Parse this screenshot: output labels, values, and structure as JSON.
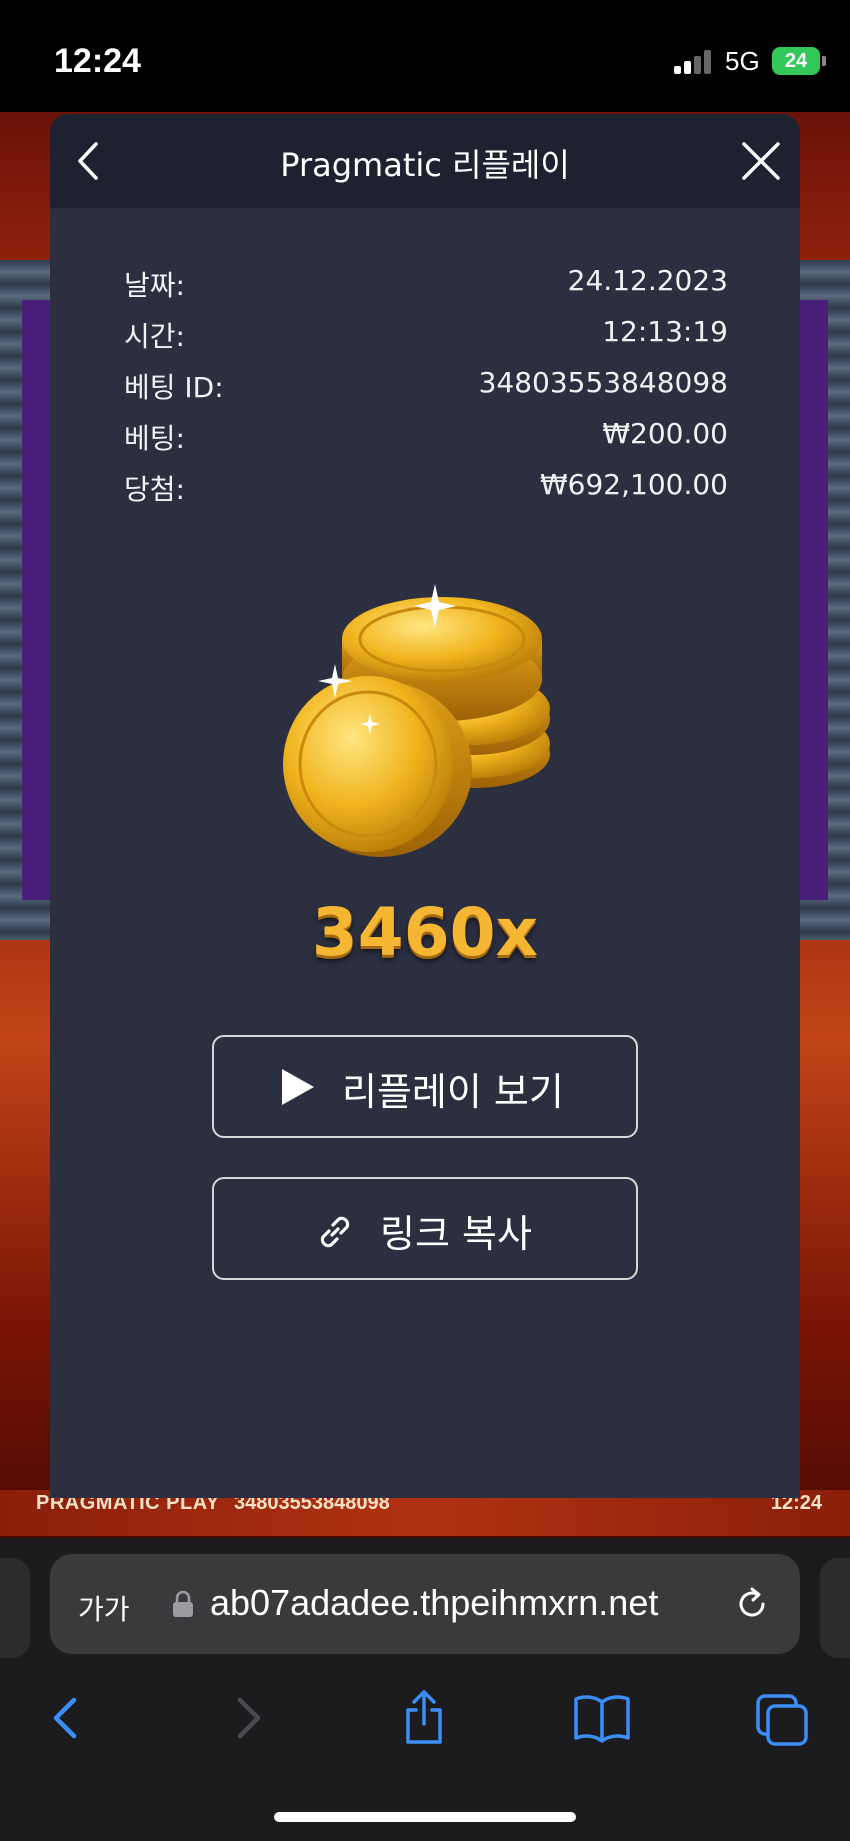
{
  "status_bar": {
    "time": "12:24",
    "network": "5G",
    "battery": "24"
  },
  "game": {
    "brand": "PRAGMATIC PLAY",
    "bet_id": "34803553848098",
    "clock": "12:24"
  },
  "modal": {
    "title": "Pragmatic 리플레이",
    "info": [
      {
        "label": "날짜:",
        "value": "24.12.2023"
      },
      {
        "label": "시간:",
        "value": "12:13:19"
      },
      {
        "label": "베팅 ID:",
        "value": "34803553848098"
      },
      {
        "label": "베팅:",
        "value": "₩200.00"
      },
      {
        "label": "당첨:",
        "value": "₩692,100.00"
      }
    ],
    "multiplier": "3460x",
    "replay_button": "리플레이 보기",
    "copy_link_button": "링크 복사"
  },
  "browser": {
    "text_size_button": "가가",
    "url": "ab07adadee.thpeihmxrn.net"
  },
  "colors": {
    "modal_bg": "#2b2f3f",
    "modal_header_bg": "#1e2130",
    "multiplier_gold": "#f5b733",
    "ios_blue": "#3a8ef6",
    "battery_green": "#34c759"
  },
  "icons": [
    "back-chevron-icon",
    "close-icon",
    "play-icon",
    "link-icon",
    "lock-icon",
    "reload-icon",
    "back-arrow-icon",
    "forward-arrow-icon",
    "share-icon",
    "bookmarks-icon",
    "tabs-icon"
  ]
}
